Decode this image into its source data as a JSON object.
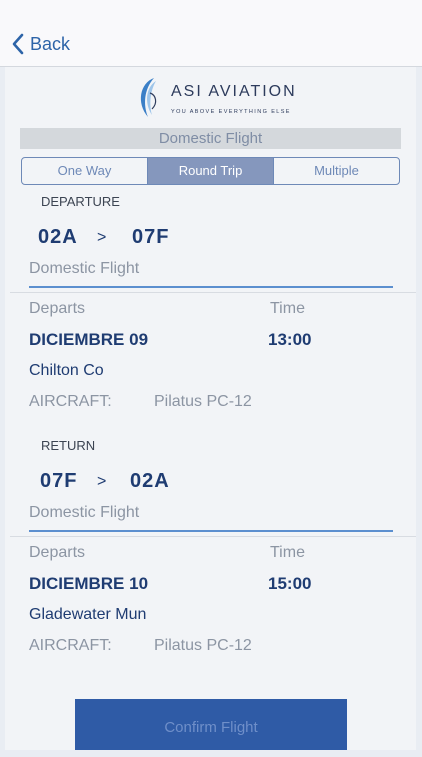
{
  "nav": {
    "back_label": "Back"
  },
  "logo": {
    "title": "ASI AVIATION",
    "tagline": "YOU ABOVE EVERYTHING ELSE"
  },
  "section_title": "Domestic Flight",
  "tabs": [
    {
      "label": "One Way"
    },
    {
      "label": "Round Trip"
    },
    {
      "label": "Multiple"
    }
  ],
  "active_tab": "Round Trip",
  "departure": {
    "heading": "DEPARTURE",
    "from": "02A",
    "arrow": ">",
    "to": "07F",
    "flight_type": "Domestic Flight",
    "departs_label": "Departs",
    "time_label": "Time",
    "date": "DICIEMBRE 09",
    "time": "13:00",
    "airport": "Chilton Co",
    "aircraft_label": "AIRCRAFT:",
    "aircraft": "Pilatus PC-12"
  },
  "return": {
    "heading": "RETURN",
    "from": "07F",
    "arrow": ">",
    "to": "02A",
    "flight_type": "Domestic Flight",
    "departs_label": "Departs",
    "time_label": "Time",
    "date": "DICIEMBRE 10",
    "time": "15:00",
    "airport": "Gladewater Mun",
    "aircraft_label": "AIRCRAFT:",
    "aircraft": "Pilatus PC-12"
  },
  "confirm_label": "Confirm Flight",
  "colors": {
    "accent": "#2f5ba6",
    "primary_text": "#1f3c72",
    "secondary_text": "#8c95a3",
    "divider": "#5c8fcf",
    "segment_active": "#8597bd"
  }
}
